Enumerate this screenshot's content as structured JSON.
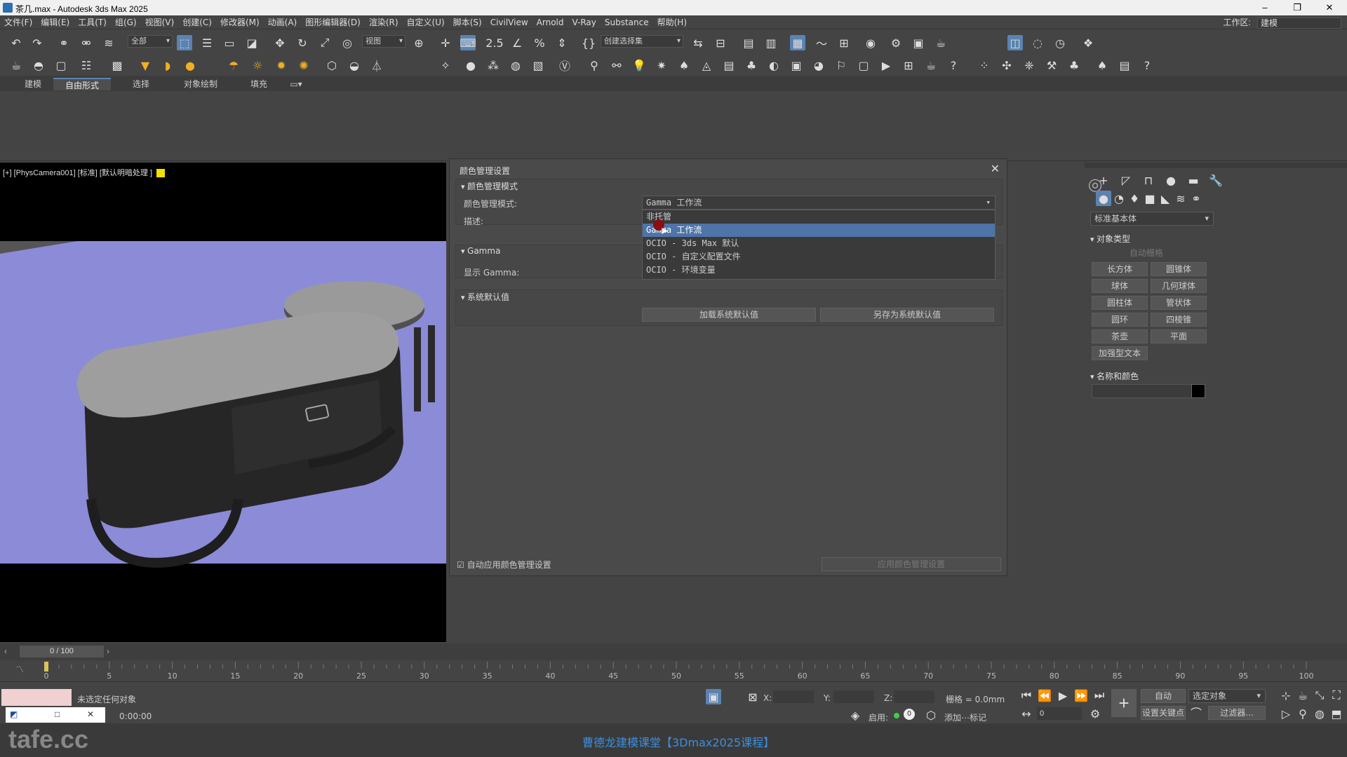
{
  "titlebar": {
    "title": "茶几.max - Autodesk 3ds Max 2025",
    "min": "–",
    "max": "❐",
    "close": "✕"
  },
  "menubar": {
    "items": [
      "文件(F)",
      "编辑(E)",
      "工具(T)",
      "组(G)",
      "视图(V)",
      "创建(C)",
      "修改器(M)",
      "动画(A)",
      "图形编辑器(D)",
      "渲染(R)",
      "自定义(U)",
      "脚本(S)",
      "CivilView",
      "Arnold",
      "V-Ray",
      "Substance",
      "帮助(H)"
    ],
    "workspace_label": "工作区:",
    "workspace_value": "建模"
  },
  "toolbar1": {
    "filter_value": "全部",
    "view_value": "视图",
    "selset_value": "创建选择集"
  },
  "ribbon": {
    "tabs": [
      "建模",
      "自由形式",
      "选择",
      "对象绘制",
      "填充"
    ],
    "active": "自由形式"
  },
  "viewport": {
    "label": "[+] [PhysCamera001] [标准] [默认明暗处理 ]",
    "bg_color": "#8b8bd8"
  },
  "dialog": {
    "title": "颜色管理设置",
    "close": "✕",
    "sec1": "颜色管理模式",
    "mode_label": "颜色管理模式:",
    "mode_value": "Gamma 工作流",
    "desc_label": "描述:",
    "options": [
      "非托管",
      "Gamma 工作流",
      "OCIO - 3ds Max 默认",
      "OCIO - 自定义配置文件",
      "OCIO - 环境变量"
    ],
    "selected_index": 1,
    "sec2": "Gamma",
    "gamma_label": "显示 Gamma:",
    "sec3": "系统默认值",
    "load_btn": "加载系统默认值",
    "save_btn": "另存为系统默认值",
    "auto_apply": "自动应用颜色管理设置",
    "apply_btn": "应用颜色管理设置"
  },
  "cmdpanel": {
    "dropdown": "标准基本体",
    "roll_objtype": "对象类型",
    "autogrid": "自动栅格",
    "buttons": [
      "长方体",
      "圆锥体",
      "球体",
      "几何球体",
      "圆柱体",
      "管状体",
      "圆环",
      "四棱锥",
      "茶壶",
      "平面",
      "加强型文本"
    ],
    "roll_name": "名称和颜色"
  },
  "timeline": {
    "frame": "0 / 100",
    "ticks": [
      "0",
      "5",
      "10",
      "15",
      "20",
      "25",
      "30",
      "35",
      "40",
      "45",
      "50",
      "55",
      "60",
      "65",
      "70",
      "75",
      "80",
      "85",
      "90",
      "95",
      "100"
    ]
  },
  "status": {
    "selection": "未选定任何对象",
    "time": "0:00:00",
    "x_label": "X:",
    "y_label": "Y:",
    "z_label": "Z:",
    "grid": "栅格 = 0.0mm",
    "enable": "启用:",
    "add_tag": "添加⋯标记",
    "auto": "自动",
    "selobj": "选定对象",
    "setkey": "设置关键点",
    "filter": "过滤器...",
    "frame_field": "0"
  },
  "footer": {
    "watermark": "tafe.cc",
    "caption": "曹德龙建模课堂【3Dmax2025课程】"
  }
}
